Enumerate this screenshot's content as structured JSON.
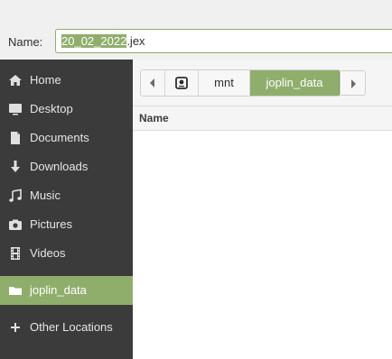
{
  "name_row": {
    "label": "Name:",
    "value_selected": "20_02_2022",
    "value_rest": ".jex"
  },
  "sidebar": {
    "items": [
      {
        "label": "Home",
        "icon": "home-icon"
      },
      {
        "label": "Desktop",
        "icon": "desktop-icon"
      },
      {
        "label": "Documents",
        "icon": "documents-icon"
      },
      {
        "label": "Downloads",
        "icon": "downloads-icon"
      },
      {
        "label": "Music",
        "icon": "music-icon"
      },
      {
        "label": "Pictures",
        "icon": "pictures-icon"
      },
      {
        "label": "Videos",
        "icon": "videos-icon"
      },
      {
        "label": "joplin_data",
        "icon": "drive-icon",
        "active": true
      },
      {
        "label": "Other Locations",
        "icon": "plus-icon"
      }
    ]
  },
  "pathbar": {
    "segments": [
      "mnt",
      "joplin_data"
    ],
    "active_segment": "joplin_data"
  },
  "list": {
    "columns": [
      "Name"
    ]
  },
  "colors": {
    "accent": "#8fae6c",
    "sidebar_bg": "#3b3b3b"
  }
}
